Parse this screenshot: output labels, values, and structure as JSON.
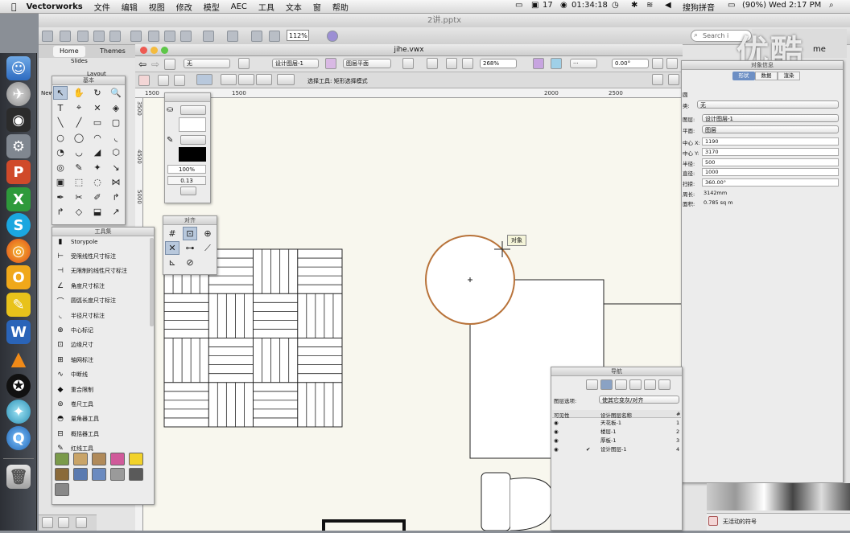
{
  "menubar": {
    "app": "Vectorworks",
    "items": [
      "文件",
      "编辑",
      "视图",
      "修改",
      "模型",
      "AEC",
      "工具",
      "文本",
      "窗",
      "帮助"
    ],
    "status_num": "17",
    "clock": "01:34:18",
    "input_method": "搜狗拼音",
    "battery": "(90%)",
    "datetime": "Wed 2:17 PM"
  },
  "ppt": {
    "title": "2讲.pptx",
    "zoom": "112%",
    "search_placeholder": "Search i",
    "tab_home": "Home",
    "tab_themes": "Themes",
    "slides_label": "Slides",
    "layout_label": "Layout",
    "new_label": "New"
  },
  "watermark": "优酷",
  "vw": {
    "title": "jihe.vwx",
    "class_select": "无",
    "layer_select": "设计图层-1",
    "view_select": "图层平面",
    "zoom": "268%",
    "angle": "0.00°",
    "mode_text": "选择工具: 矩形选择模式"
  },
  "ruler": {
    "top": [
      "1500",
      "1000",
      "1500",
      "2000",
      "2500"
    ],
    "left": [
      "3500",
      "4500",
      "5000"
    ]
  },
  "basic_palette": {
    "title": "基本"
  },
  "attr_palette": {
    "opacity": "100%",
    "line_weight": "0.13"
  },
  "snap_palette": {
    "title": "对齐"
  },
  "toolset": {
    "title": "工具集",
    "items": [
      "Storypole",
      "受限线性尺寸标注",
      "无限制的线性尺寸标注",
      "角度尺寸标注",
      "圆弧长度尺寸标注",
      "半径尺寸标注",
      "中心标记",
      "边缘尺寸",
      "轴网标注",
      "中断线",
      "重合限制",
      "卷尺工具",
      "量角器工具",
      "概括器工具",
      "红线工具"
    ]
  },
  "tooltip": "对象",
  "obj_info": {
    "title": "对象信息",
    "tabs": [
      "形状",
      "数据",
      "渲染"
    ],
    "shape_kind": "圆",
    "class_label": "类:",
    "class_value": "无",
    "layer_label": "图层:",
    "layer_value": "设计图层-1",
    "plane_label": "平面:",
    "plane_value": "图层",
    "center_x_label": "中心 X:",
    "center_x": "1190",
    "center_y_label": "中心 Y:",
    "center_y": "3170",
    "radius_label": "半径:",
    "radius": "500",
    "diameter_label": "直径:",
    "diameter": "1000",
    "sweep_label": "扫掠:",
    "sweep": "360.00°",
    "perimeter_label": "周长:",
    "perimeter": "3142mm",
    "area_label": "面积:",
    "area": "0.785 sq m"
  },
  "navigator": {
    "title": "导航",
    "layer_opts_label": "图层选项:",
    "layer_opts_value": "使其它变灰/对齐",
    "col_visible": "可见性",
    "col_name": "设计图层名称",
    "col_num": "#",
    "rows": [
      {
        "name": "天花板-1",
        "num": "1",
        "active": false
      },
      {
        "name": "楼层-1",
        "num": "2",
        "active": false
      },
      {
        "name": "厚板-1",
        "num": "3",
        "active": false
      },
      {
        "name": "设计图层-1",
        "num": "4",
        "active": true
      }
    ]
  },
  "bottom_status": "无活动的符号",
  "colors": {
    "circle_stroke": "#b8733a",
    "canvas": "#f8f7ee"
  }
}
